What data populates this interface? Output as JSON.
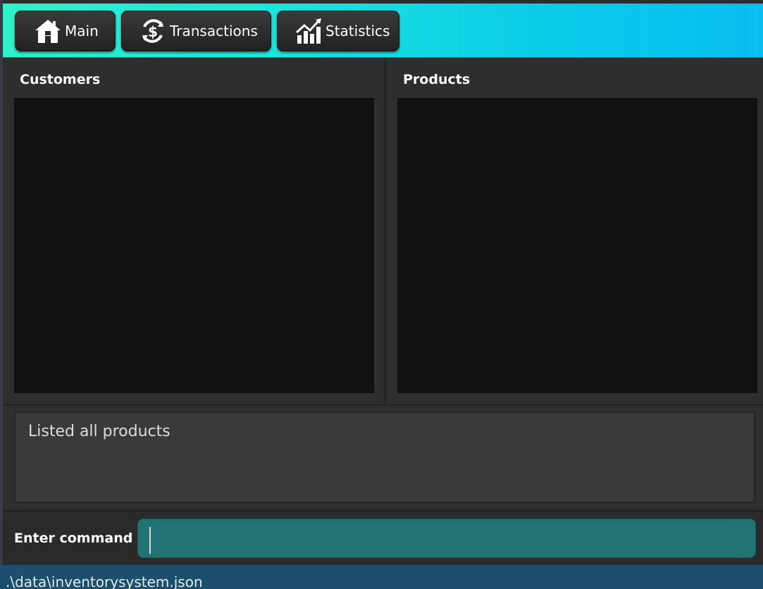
{
  "toolbar": {
    "tabs": [
      {
        "label": "Main",
        "icon": "home-icon"
      },
      {
        "label": "Transactions",
        "icon": "dollar-cycle-icon"
      },
      {
        "label": "Statistics",
        "icon": "chart-up-icon"
      }
    ],
    "gradient_colors": [
      "#2ef0c9",
      "#08bdf2"
    ]
  },
  "panels": {
    "customers": {
      "title": "Customers"
    },
    "products": {
      "title": "Products"
    }
  },
  "result": {
    "text": "Listed all products"
  },
  "command": {
    "label": "Enter command",
    "value": ""
  },
  "status": {
    "path": ".\\data\\inventorysystem.json"
  },
  "colors": {
    "command_input_bg": "#217374",
    "status_bar_bg": "#1b4f6d",
    "list_bg": "#111111"
  }
}
